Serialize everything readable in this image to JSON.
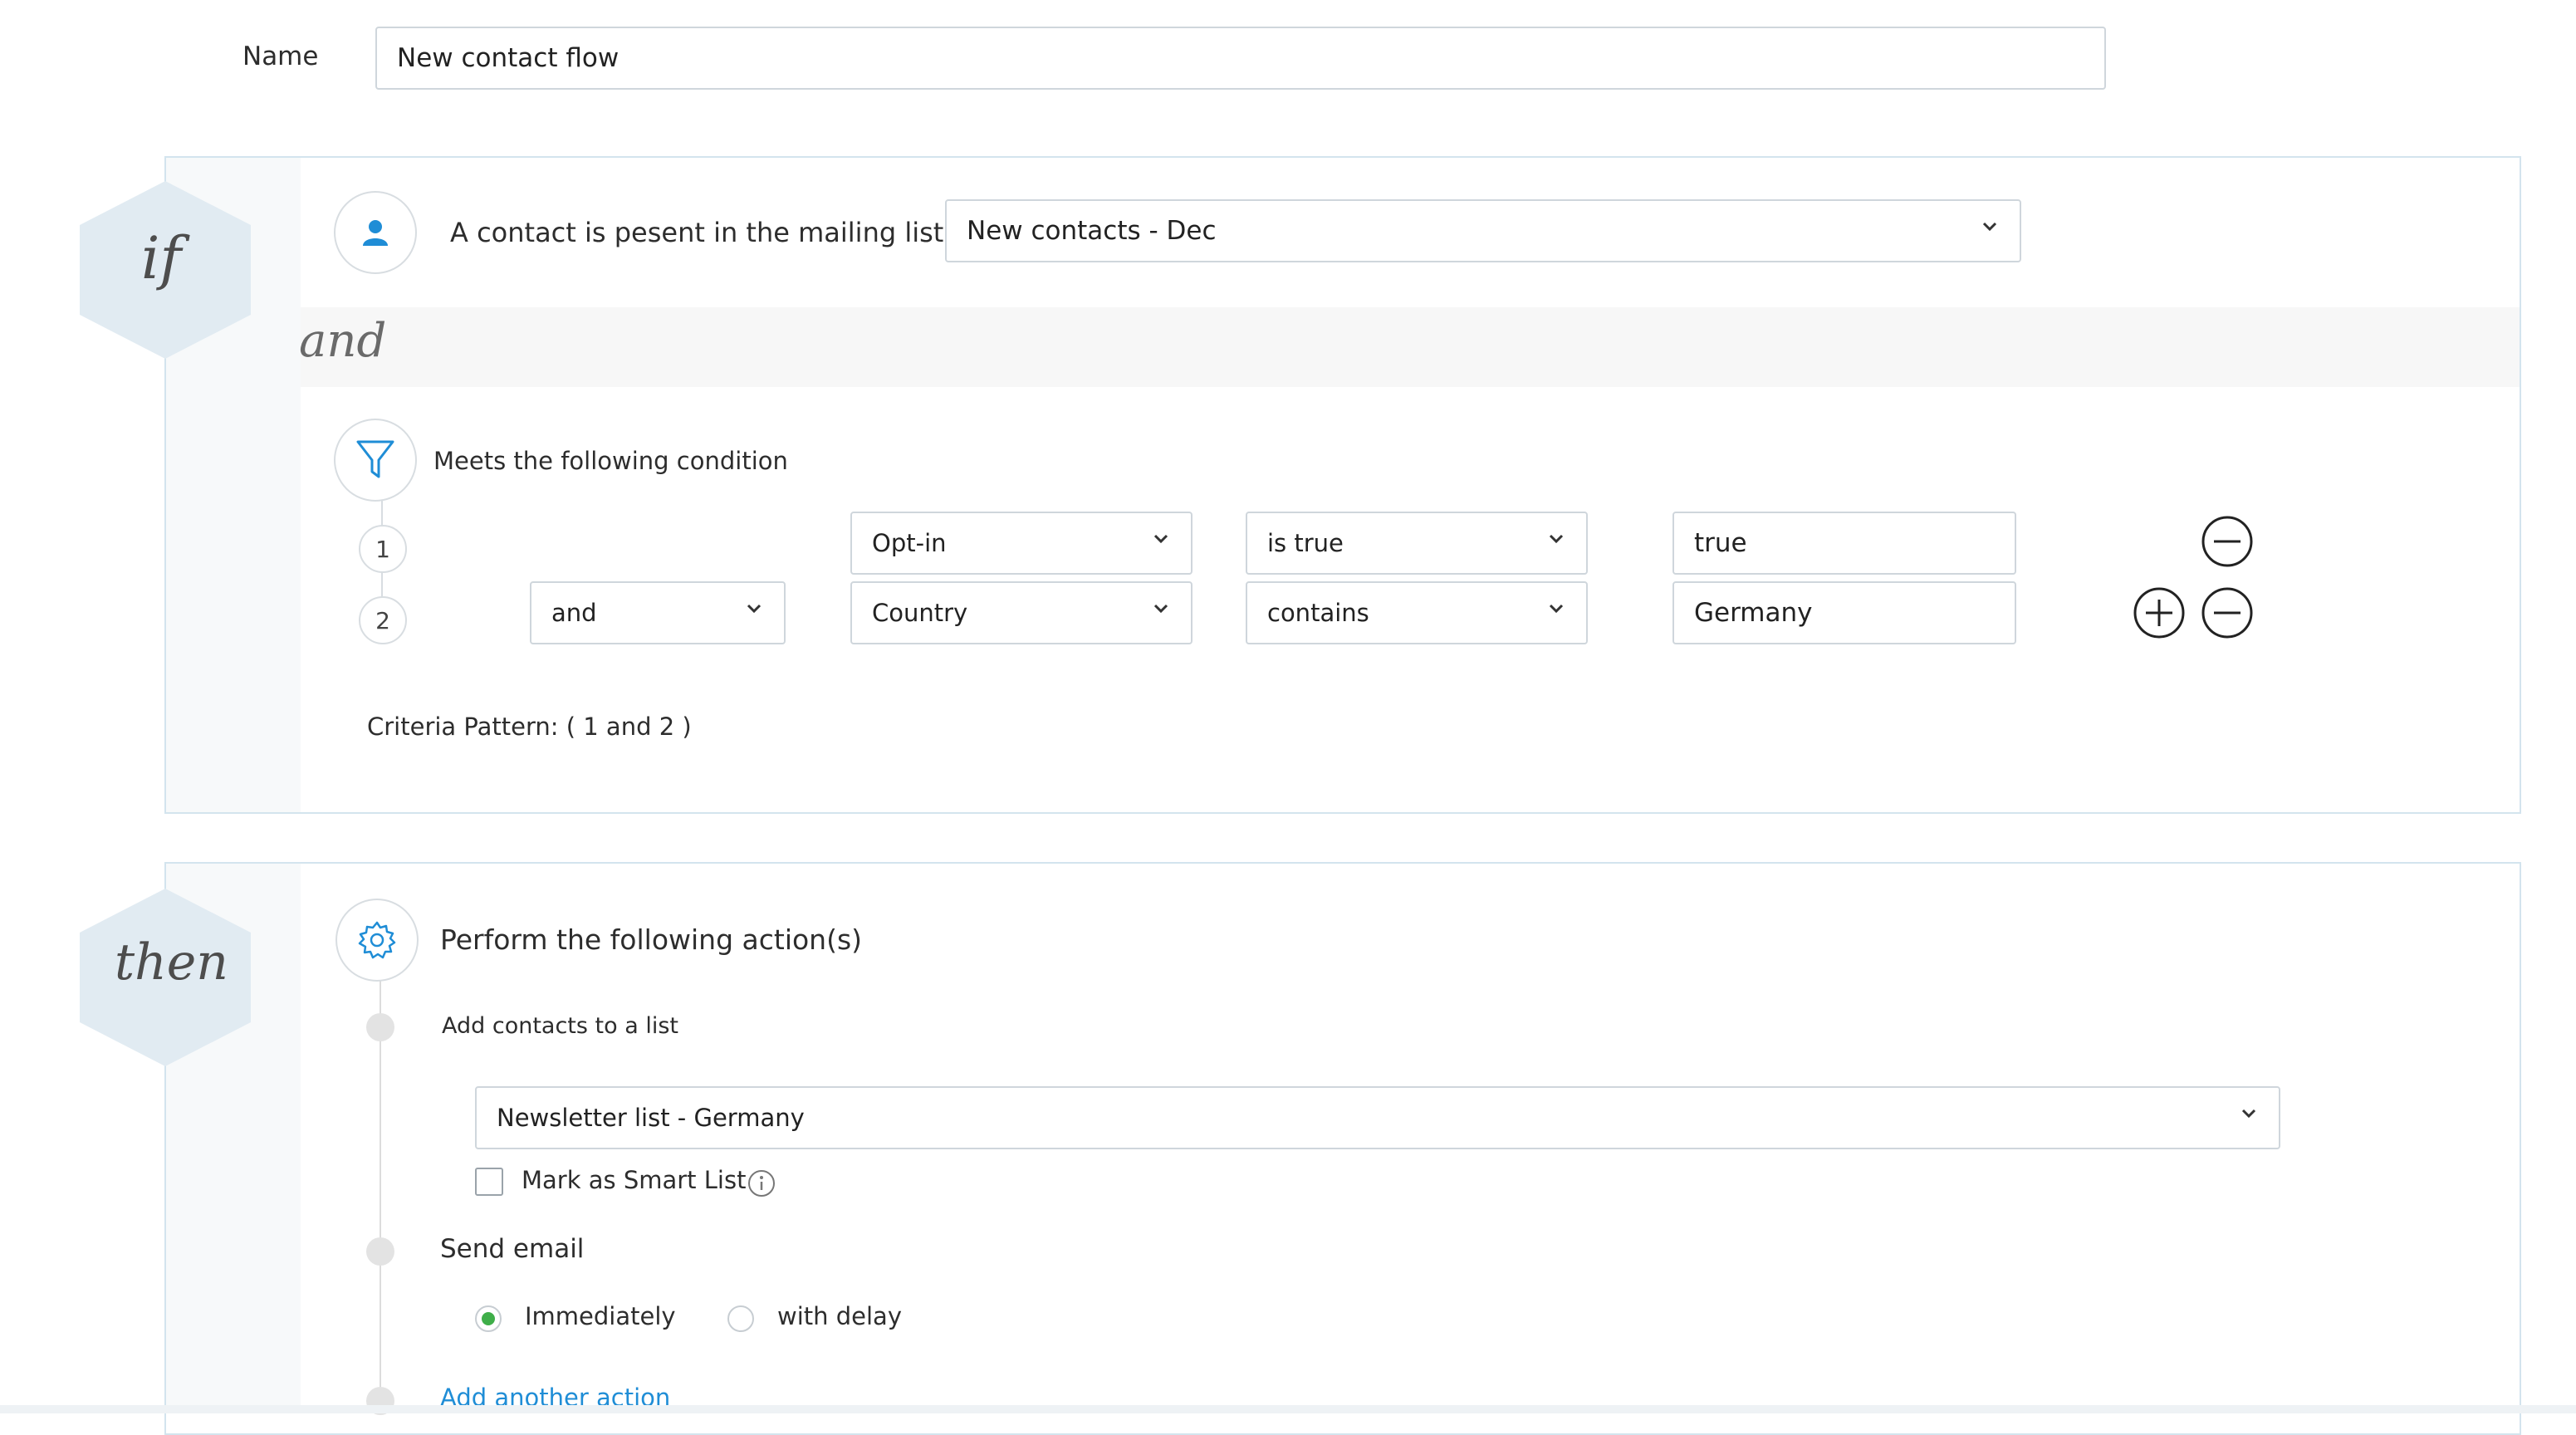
{
  "name_row": {
    "label": "Name",
    "value": "New contact flow"
  },
  "if_section": {
    "badge": "if",
    "trigger_text": "A contact is pesent in the mailing list",
    "list_select": "New contacts - Dec",
    "and_divider": "and",
    "condition_title": "Meets the following condition",
    "conditions": [
      {
        "index": "1",
        "connector": "",
        "field": "Opt-in",
        "operator": "is true",
        "value": "true"
      },
      {
        "index": "2",
        "connector": "and",
        "field": "Country",
        "operator": "contains",
        "value": "Germany"
      }
    ],
    "criteria_pattern": "Criteria Pattern: ( 1 and 2 )"
  },
  "then_section": {
    "badge": "then",
    "title": "Perform the following action(s)",
    "action1_label": "Add contacts to a list",
    "list_select": "Newsletter list - Germany",
    "smart_list_label": "Mark as Smart List",
    "action2_label": "Send email",
    "radio_immediately": "Immediately",
    "radio_delay": "with delay",
    "selected_radio": "Immediately",
    "add_action": "Add another action"
  },
  "colors": {
    "accent": "#1f8dd6",
    "hex_badge": "#e1ebf2",
    "panel_border": "#d3e4ee",
    "radio_selected": "#3fae49"
  },
  "icons": [
    "person-icon",
    "funnel-icon",
    "gear-icon",
    "chevron-down-icon",
    "plus-circle-icon",
    "minus-circle-icon",
    "info-icon"
  ]
}
